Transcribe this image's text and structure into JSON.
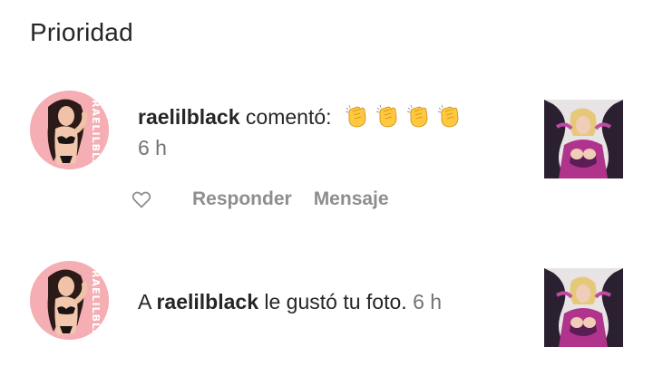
{
  "section": {
    "title": "Prioridad"
  },
  "notifications": [
    {
      "avatar_watermark": "RAELILBLA",
      "username": "raelilblack",
      "text_after": " comentó:",
      "emojis": [
        "clapping-hands",
        "clapping-hands",
        "clapping-hands",
        "clapping-hands"
      ],
      "time": "6 h",
      "actions": {
        "reply": "Responder",
        "message": "Mensaje"
      },
      "thumbnail_icon": "photo-thumbnail"
    },
    {
      "avatar_watermark": "RAELILBLA",
      "prefix": "A ",
      "username": "raelilblack",
      "text_after": " le gustó tu foto.",
      "time": "6 h",
      "thumbnail_icon": "photo-thumbnail"
    }
  ],
  "colors": {
    "text": "#262626",
    "secondary": "#737373",
    "action": "#8e8e8e",
    "avatar_bg": "#f5aeb3",
    "emoji_yellow": "#ffc83d"
  }
}
